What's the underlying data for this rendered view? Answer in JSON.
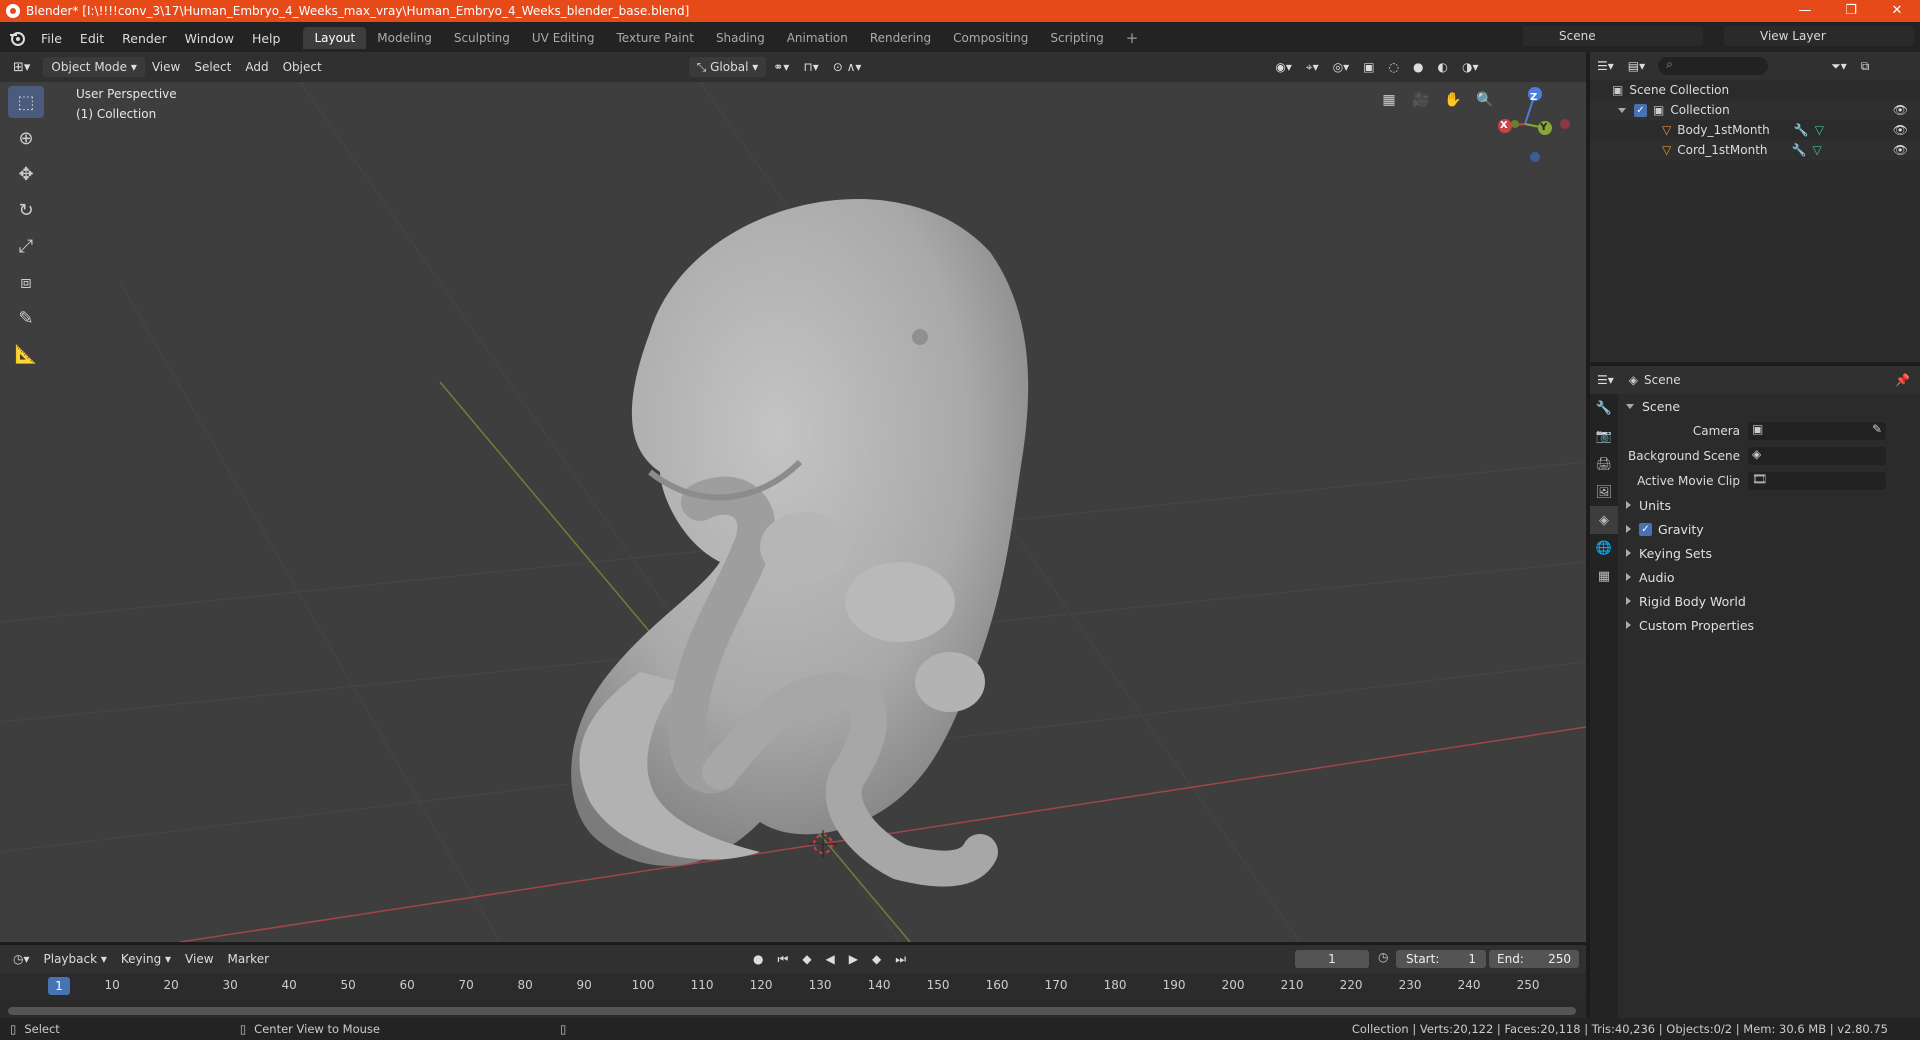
{
  "window": {
    "title": "Blender* [I:\\!!!!conv_3\\17\\Human_Embryo_4_Weeks_max_vray\\Human_Embryo_4_Weeks_blender_base.blend]",
    "minimize": "—",
    "maximize": "❐",
    "close": "✕"
  },
  "menu": {
    "items": [
      "File",
      "Edit",
      "Render",
      "Window",
      "Help"
    ]
  },
  "workspaces": {
    "tabs": [
      "Layout",
      "Modeling",
      "Sculpting",
      "UV Editing",
      "Texture Paint",
      "Shading",
      "Animation",
      "Rendering",
      "Compositing",
      "Scripting"
    ],
    "active": "Layout",
    "add": "+"
  },
  "scene_selector": {
    "value": "Scene"
  },
  "view_layer_selector": {
    "value": "View Layer"
  },
  "viewport_header": {
    "mode": "Object Mode",
    "menus": [
      "View",
      "Select",
      "Add",
      "Object"
    ],
    "orientation": "Global"
  },
  "viewport": {
    "perspective": "User Perspective",
    "collection": "(1) Collection",
    "background": "#3e3e3e",
    "axis_x_color": "#c8444b",
    "axis_y_color": "#8aa53a",
    "axis_z_color": "#4a7ed8"
  },
  "gizmo": {
    "x": "X",
    "y": "Y",
    "z": "Z"
  },
  "outliner": {
    "root": "Scene Collection",
    "collection": "Collection",
    "objects": [
      "Body_1stMonth",
      "Cord_1stMonth"
    ]
  },
  "properties": {
    "header": "Scene",
    "section": "Scene",
    "fields": {
      "camera": "Camera",
      "background_scene": "Background Scene",
      "active_movie_clip": "Active Movie Clip"
    },
    "subsections": {
      "units": "Units",
      "gravity": "Gravity",
      "keying_sets": "Keying Sets",
      "audio": "Audio",
      "rigid_body_world": "Rigid Body World",
      "custom_properties": "Custom Properties"
    },
    "gravity_checked": true
  },
  "timeline": {
    "menus": [
      "Playback",
      "Keying",
      "View",
      "Marker"
    ],
    "current_frame": "1",
    "start_label": "Start:",
    "start": "1",
    "end_label": "End:",
    "end": "250",
    "ruler": [
      "1",
      "10",
      "20",
      "30",
      "40",
      "50",
      "60",
      "70",
      "80",
      "90",
      "100",
      "110",
      "120",
      "130",
      "140",
      "150",
      "160",
      "170",
      "180",
      "190",
      "200",
      "210",
      "220",
      "230",
      "240",
      "250"
    ]
  },
  "statusbar": {
    "select": "Select",
    "center": "Center View to Mouse",
    "stats": "Collection | Verts:20,122 | Faces:20,118 | Tris:40,236 | Objects:0/2 | Mem: 30.6 MB | v2.80.75"
  }
}
